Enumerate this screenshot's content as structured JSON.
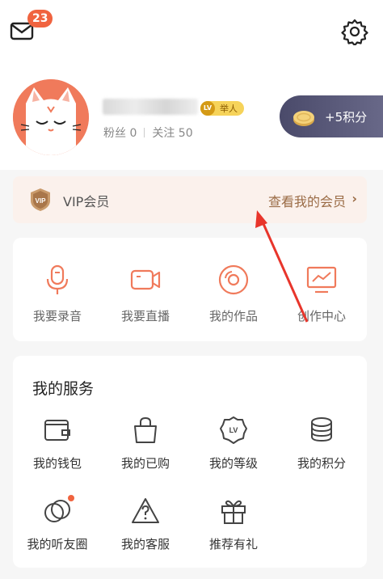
{
  "header": {
    "mail_badge": "23",
    "icons": [
      "mail-icon",
      "gear-icon"
    ]
  },
  "profile": {
    "level_badge": "LV",
    "level_title": "举人",
    "fans_label": "粉丝 0",
    "follow_label": "关注 50",
    "points_label": "+5积分"
  },
  "vip": {
    "label": "VIP会员",
    "link": "查看我的会员",
    "icon_text": "VIP"
  },
  "actions": [
    {
      "label": "我要录音",
      "icon": "microphone-icon"
    },
    {
      "label": "我要直播",
      "icon": "video-camera-icon"
    },
    {
      "label": "我的作品",
      "icon": "disc-icon"
    },
    {
      "label": "创作中心",
      "icon": "monitor-chart-icon"
    }
  ],
  "services": {
    "title": "我的服务",
    "items": [
      {
        "label": "我的钱包",
        "icon": "wallet-icon"
      },
      {
        "label": "我的已购",
        "icon": "shopping-bag-icon"
      },
      {
        "label": "我的等级",
        "icon": "level-badge-icon"
      },
      {
        "label": "我的积分",
        "icon": "coins-stack-icon"
      },
      {
        "label": "我的听友圈",
        "icon": "friend-circle-icon"
      },
      {
        "label": "我的客服",
        "icon": "help-warning-icon"
      },
      {
        "label": "推荐有礼",
        "icon": "gift-icon"
      }
    ]
  },
  "colors": {
    "accent": "#f0633f",
    "vip_bg": "#fbf1ec",
    "vip_text": "#9a6b45",
    "annotation_arrow": "#e8352b"
  }
}
